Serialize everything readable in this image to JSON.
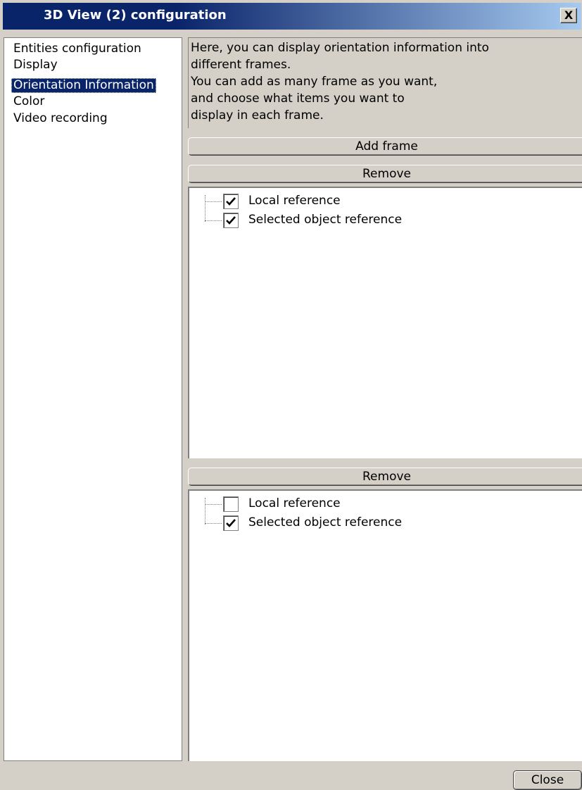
{
  "window": {
    "title": "3D View (2) configuration",
    "close_glyph": "X"
  },
  "nav": {
    "items": [
      {
        "label": "Entities configuration",
        "selected": false
      },
      {
        "label": "Display",
        "selected": false
      },
      {
        "label": "Orientation Information",
        "selected": true
      },
      {
        "label": "Color",
        "selected": false
      },
      {
        "label": "Video recording",
        "selected": false
      }
    ]
  },
  "description": {
    "lines": [
      "Here, you can display orientation information into",
      "different frames.",
      " You can add as many frame as you want,",
      " and choose what items you want to",
      " display in each frame."
    ]
  },
  "buttons": {
    "add_frame": "Add frame",
    "remove": "Remove",
    "close": "Close"
  },
  "frames": [
    {
      "items": [
        {
          "label": "Local reference",
          "checked": true
        },
        {
          "label": "Selected object reference",
          "checked": true
        }
      ]
    },
    {
      "items": [
        {
          "label": "Local reference",
          "checked": false
        },
        {
          "label": "Selected object reference",
          "checked": true
        }
      ]
    }
  ],
  "colors": {
    "selection": "#0a246a",
    "face": "#d4d0c8"
  }
}
